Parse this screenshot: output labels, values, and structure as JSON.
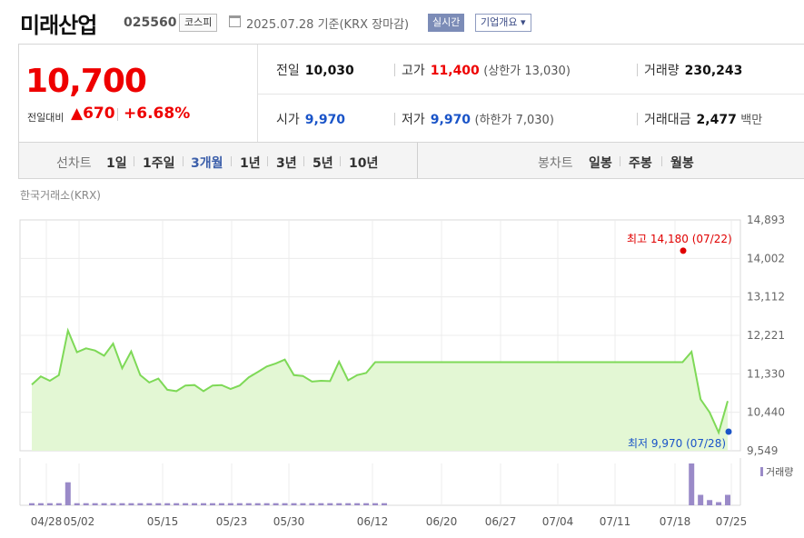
{
  "header": {
    "name": "미래산업",
    "code": "025560",
    "market": "코스피",
    "date": "2025.07.28 기준(KRX 장마감)",
    "realtime": "실시간",
    "company_overview": "기업개요 ▾"
  },
  "quote": {
    "price": "10,700",
    "change_label": "전일대비",
    "change": "▲670",
    "change_pct": "+6.68%",
    "prev_close_label": "전일",
    "prev_close": "10,030",
    "high_label": "고가",
    "high": "11,400",
    "upper_limit": "(상한가 13,030)",
    "volume_label": "거래량",
    "volume": "230,243",
    "open_label": "시가",
    "open": "9,970",
    "low_label": "저가",
    "low": "9,970",
    "lower_limit": "(하한가 7,030)",
    "amount_label": "거래대금",
    "amount": "2,477",
    "amount_unit": "백만"
  },
  "periods": {
    "line_label": "선차트",
    "line_items": [
      "1일",
      "1주일",
      "3개월",
      "1년",
      "3년",
      "5년",
      "10년"
    ],
    "selected": "3개월",
    "candle_label": "봉차트",
    "candle_items": [
      "일봉",
      "주봉",
      "월봉"
    ]
  },
  "exchange_label": "한국거래소(KRX)",
  "colors": {
    "up": "#e00000",
    "down": "#1a54c8",
    "line": "#7ed957",
    "fill": "#e3f7d4",
    "volume": "#9a8ac8"
  },
  "chart_data": {
    "type": "area",
    "y_ticks": [
      "14,893",
      "14,002",
      "13,112",
      "12,221",
      "11,330",
      "10,440",
      "9,549"
    ],
    "ylim": [
      9549,
      14893
    ],
    "x_ticks": [
      "04/28",
      "05/02",
      "05/15",
      "05/23",
      "05/30",
      "06/12",
      "06/20",
      "06/27",
      "07/04",
      "07/11",
      "07/18",
      "07/25"
    ],
    "max_label": "최고 14,180 (07/22)",
    "max": {
      "value": 14180,
      "date": "07/22"
    },
    "min_label": "최저 9,970 (07/28)",
    "min": {
      "value": 9970,
      "date": "07/28"
    },
    "prices": [
      11080,
      11270,
      11170,
      11300,
      12330,
      11830,
      11920,
      11870,
      11750,
      12030,
      11460,
      11850,
      11300,
      11130,
      11220,
      10960,
      10930,
      11060,
      11070,
      10930,
      11060,
      11070,
      10980,
      11060,
      11250,
      11370,
      11500,
      11570,
      11660,
      11300,
      11280,
      11150,
      11170,
      11160,
      11610,
      11180,
      11300,
      11350,
      11600,
      11600,
      11600,
      11600,
      11600,
      11600,
      11600,
      11600,
      11600,
      11600,
      11600,
      11600,
      11600,
      11600,
      11600,
      11600,
      11600,
      11600,
      11600,
      11600,
      11600,
      11600,
      11600,
      11600,
      11600,
      11600,
      11600,
      11600,
      11600,
      11600,
      11600,
      11600,
      11600,
      11600,
      11600,
      11840,
      10740,
      10440,
      9970,
      10700
    ],
    "volume_label": "거래량",
    "volumes": [
      2,
      2,
      2,
      2,
      22,
      2,
      2,
      2,
      2,
      2,
      2,
      2,
      2,
      2,
      2,
      2,
      2,
      2,
      2,
      2,
      2,
      2,
      2,
      2,
      2,
      2,
      2,
      2,
      2,
      2,
      2,
      2,
      2,
      2,
      2,
      2,
      2,
      2,
      2,
      2,
      0,
      0,
      0,
      0,
      0,
      0,
      0,
      0,
      0,
      0,
      0,
      0,
      0,
      0,
      0,
      0,
      0,
      0,
      0,
      0,
      0,
      0,
      0,
      0,
      0,
      0,
      0,
      0,
      0,
      0,
      0,
      0,
      0,
      40,
      10,
      5,
      3,
      10
    ],
    "grid": true
  }
}
